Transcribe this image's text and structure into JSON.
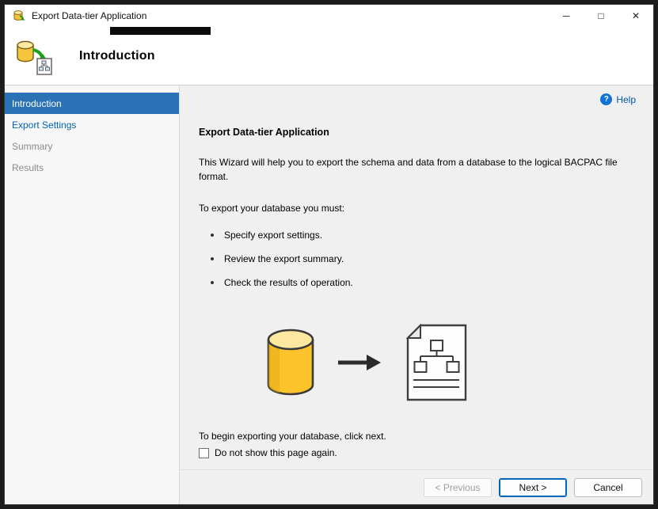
{
  "window": {
    "title": "Export Data-tier Application",
    "controls": {
      "minimize": "─",
      "maximize": "□",
      "close": "✕"
    }
  },
  "header": {
    "title": "Introduction"
  },
  "sidebar": {
    "active_index": 0,
    "items": [
      {
        "label": "Introduction",
        "state": "active"
      },
      {
        "label": "Export Settings",
        "state": "link"
      },
      {
        "label": "Summary",
        "state": "disabled"
      },
      {
        "label": "Results",
        "state": "disabled"
      }
    ]
  },
  "content": {
    "help_label": "Help",
    "help_glyph": "?",
    "heading": "Export Data-tier Application",
    "intro": "This Wizard will help you to export the schema and data from a database to the logical BACPAC file format.",
    "requirements_label": "To export your database you must:",
    "bullets": [
      "Specify export settings.",
      "Review the export summary.",
      "Check the results of operation."
    ],
    "begin_text": "To begin exporting your database, click next.",
    "checkbox_label": "Do not show this page again.",
    "checkbox_checked": false
  },
  "buttons": {
    "previous": "< Previous",
    "next": "Next >",
    "cancel": "Cancel"
  },
  "icons": {
    "app": "database-export-icon",
    "header": "database-export-icon",
    "help": "help-question-icon",
    "graphic_left": "database-cylinder-icon",
    "graphic_middle": "right-arrow-icon",
    "graphic_right": "bacpac-file-icon"
  },
  "colors": {
    "accent_blue": "#2a72b5",
    "link_blue": "#0063b1",
    "disabled_gray": "#8a8a8a",
    "db_yellow": "#fcc200",
    "help_blue": "#1273d2"
  }
}
